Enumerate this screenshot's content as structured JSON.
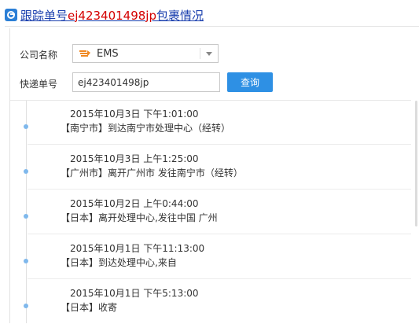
{
  "header": {
    "title_prefix": "跟踪单号",
    "tracking_number": "ej423401498jp",
    "title_suffix": "包裹情况"
  },
  "form": {
    "company_label": "公司名称",
    "company_value": "EMS",
    "tracking_label": "快递单号",
    "tracking_value": "ej423401498jp",
    "query_button": "查询"
  },
  "events": [
    {
      "time": "2015年10月3日 下午1:01:00",
      "desc": "【南宁市】到达南宁市处理中心（经转）"
    },
    {
      "time": "2015年10月3日 上午1:25:00",
      "desc": "【广州市】离开广州市 发往南宁市（经转）"
    },
    {
      "time": "2015年10月2日 上午0:44:00",
      "desc": "【日本】离开处理中心,发往中国 广州"
    },
    {
      "time": "2015年10月1日 下午11:13:00",
      "desc": "【日本】到达处理中心,来自"
    },
    {
      "time": "2015年10月1日 下午5:13:00",
      "desc": "【日本】收寄"
    }
  ],
  "colors": {
    "title_link": "#1a3fae",
    "tracking_number": "#d40000",
    "button": "#2e90e4",
    "timeline_dot": "#7fb8ec"
  },
  "icons": {
    "logo": "app-logo-icon",
    "company": "ems-truck-icon",
    "dropdown": "chevron-down-icon"
  }
}
